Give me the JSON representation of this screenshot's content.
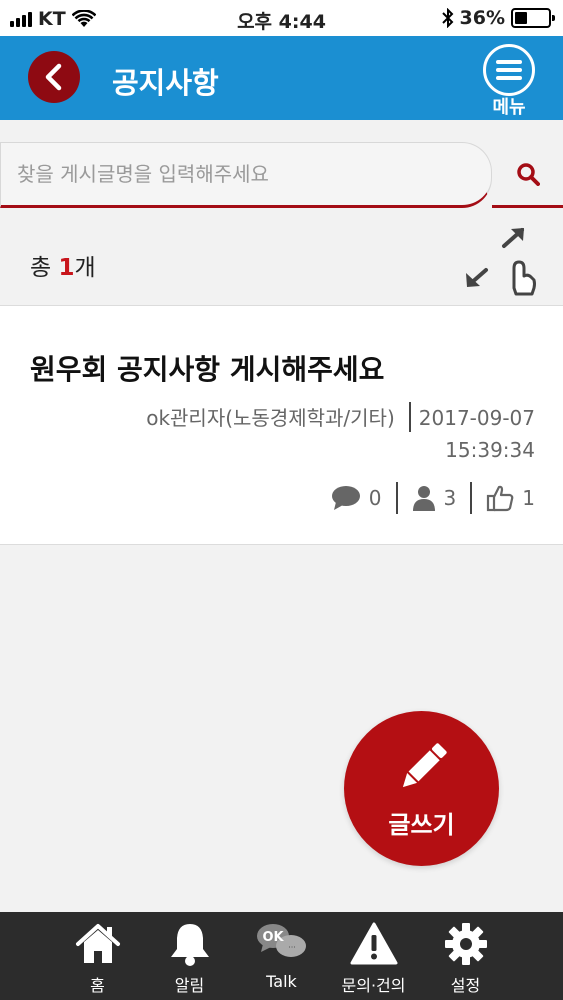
{
  "status_bar": {
    "carrier": "KT",
    "time": "오후 4:44",
    "battery": "36%",
    "battery_level": 0.36
  },
  "header": {
    "title": "공지사항",
    "menu_label": "메뉴"
  },
  "search": {
    "placeholder": "찾을 게시글명을 입력해주세요"
  },
  "count": {
    "prefix": "총 ",
    "number": "1",
    "suffix": "개"
  },
  "posts": [
    {
      "title": "원우회 공지사항 게시해주세요",
      "author": "ok관리자(노동경제학과/기타)",
      "date": "2017-09-07",
      "time": "15:39:34",
      "comments": "0",
      "views": "3",
      "likes": "1"
    }
  ],
  "fab": {
    "label": "글쓰기"
  },
  "nav": [
    {
      "label": "홈",
      "icon": "home-icon"
    },
    {
      "label": "알림",
      "icon": "bell-icon"
    },
    {
      "label": "Talk",
      "icon": "ok-talk-icon"
    },
    {
      "label": "문의·건의",
      "icon": "warning-icon"
    },
    {
      "label": "설정",
      "icon": "gear-icon"
    }
  ],
  "colors": {
    "header": "#1b8fd2",
    "accent": "#b40f13",
    "back": "#8e0a12",
    "nav": "#2c2c2c"
  }
}
